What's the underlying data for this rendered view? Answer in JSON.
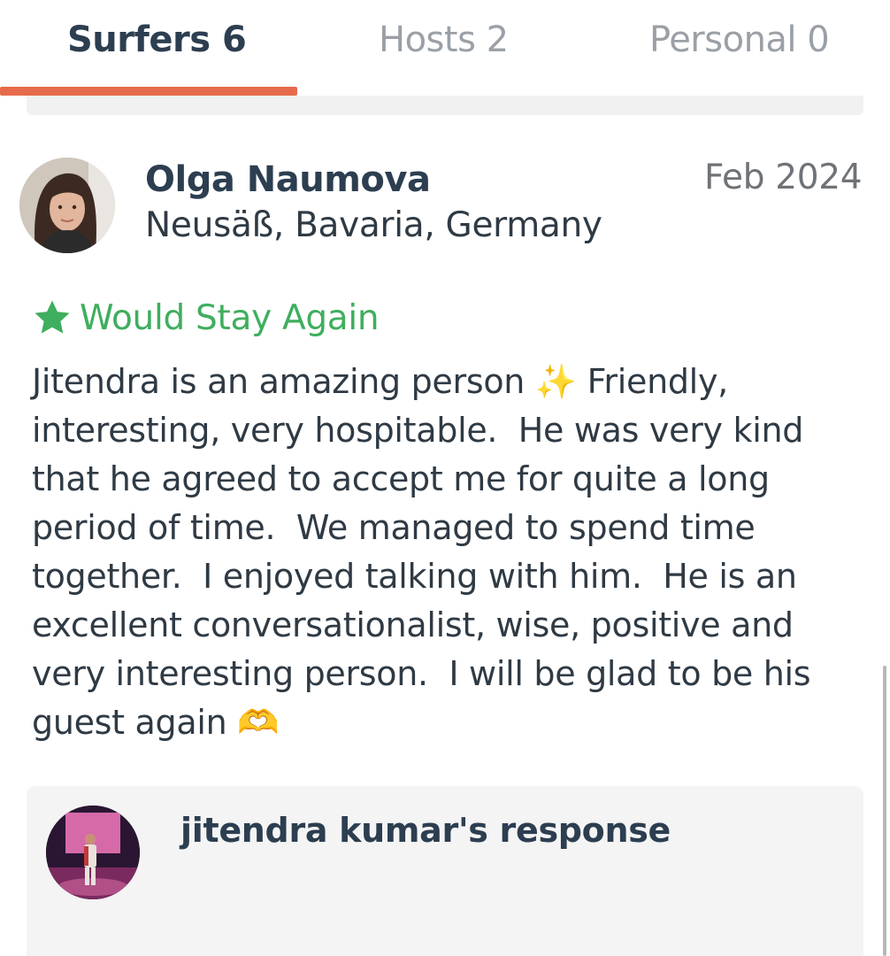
{
  "tabs": [
    {
      "label": "Surfers 6",
      "active": true
    },
    {
      "label": "Hosts 2",
      "active": false
    },
    {
      "label": "Personal 0",
      "active": false
    }
  ],
  "colors": {
    "accent": "#e66b4c",
    "stay_again": "#3fae5e",
    "text": "#2f3a44"
  },
  "review": {
    "reviewer_name": "Olga Naumova",
    "reviewer_location": "Neusäß, Bavaria, Germany",
    "date": "Feb 2024",
    "badge_icon": "star-icon",
    "badge_label": "Would Stay Again",
    "text": "Jitendra is an amazing person ✨ Friendly,\ninteresting, very hospitable.  He was very kind\nthat he agreed to accept me for quite a long\nperiod of time.  We managed to spend time\ntogether.  I enjoyed talking with him.  He is an\nexcellent conversationalist, wise, positive and\nvery interesting person.  I will be glad to be his\nguest again 🫶"
  },
  "response": {
    "title": "jitendra kumar's response"
  }
}
